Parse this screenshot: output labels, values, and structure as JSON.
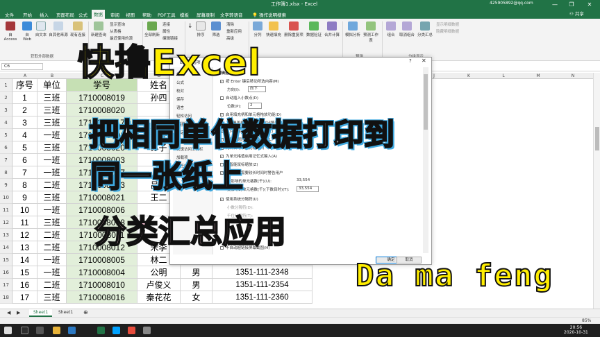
{
  "window": {
    "title": "工作簿1.xlsx - Excel",
    "account": "425905892@qq.com",
    "minimize": "—",
    "restore": "❐",
    "close": "✕"
  },
  "menu": {
    "tabs": [
      "文件",
      "开始",
      "插入",
      "页面布局",
      "公式",
      "数据",
      "审阅",
      "视图",
      "帮助",
      "PDF工具",
      "模板",
      "屏幕录制",
      "文字转语音",
      "操作说明搜索"
    ],
    "active_index": 5,
    "share": "共享"
  },
  "ribbon": {
    "get_external_access": "自 Access",
    "get_external_web": "自 Web",
    "get_external_text": "自文本",
    "get_external_other": "自其他来源",
    "existing_connections": "现有连接",
    "new_query": "新建查询",
    "show_query": "显示查询",
    "from_table": "从表格",
    "recent_sources": "最近使用的源",
    "refresh_all": "全部刷新",
    "connections": "连接",
    "properties": "属性",
    "edit_links": "编辑链接",
    "sort_asc": "↓",
    "sort": "排序",
    "filter": "筛选",
    "clear": "清除",
    "reapply": "重新应用",
    "advanced": "高级",
    "text_to_columns": "分列",
    "flash_fill": "快速填充",
    "remove_duplicates": "删除重复项",
    "data_validation": "数据验证",
    "consolidate": "合并计算",
    "what_if": "模拟分析",
    "forecast_sheet": "预测工作表",
    "group": "组合",
    "ungroup": "取消组合",
    "subtotal": "分类汇总",
    "show_detail": "显示明细数据",
    "hide_detail": "隐藏明细数据",
    "group_external": "获取外部数据",
    "group_forecast": "预测",
    "group_outline": "分级显示"
  },
  "formula_bar": {
    "name_box": "C6"
  },
  "columns": [
    "A",
    "B",
    "C",
    "D",
    "E",
    "F",
    "G",
    "H",
    "I",
    "J",
    "K",
    "L",
    "M",
    "N"
  ],
  "rows": [
    "1",
    "2",
    "3",
    "4",
    "5",
    "6",
    "7",
    "8",
    "9",
    "10",
    "11",
    "12",
    "13",
    "14",
    "15",
    "16",
    "17",
    "18"
  ],
  "table": {
    "headers": [
      "序号",
      "单位",
      "学号",
      "姓名",
      "",
      ""
    ],
    "rows": [
      [
        "1",
        "三班",
        "1710008019",
        "孙四",
        "",
        ""
      ],
      [
        "2",
        "三班",
        "1710008020",
        "",
        "",
        ""
      ],
      [
        "3",
        "三班",
        "1710008017",
        "",
        "",
        ""
      ],
      [
        "4",
        "一班",
        "1710008001",
        "李五",
        "",
        ""
      ],
      [
        "5",
        "三班",
        "1710008020",
        "苏子",
        "",
        ""
      ],
      [
        "6",
        "一班",
        "1710008003",
        "",
        "",
        ""
      ],
      [
        "7",
        "一班",
        "1710008007",
        "",
        "",
        ""
      ],
      [
        "8",
        "二班",
        "1710008013",
        "吕名",
        "",
        ""
      ],
      [
        "9",
        "三班",
        "1710008021",
        "王二",
        "",
        ""
      ],
      [
        "10",
        "一班",
        "1710008006",
        "",
        "",
        ""
      ],
      [
        "11",
        "三班",
        "1710008018",
        "",
        "",
        ""
      ],
      [
        "12",
        "二班",
        "1710008011",
        "",
        "",
        ""
      ],
      [
        "13",
        "二班",
        "1710008012",
        "宋李",
        "",
        ""
      ],
      [
        "14",
        "一班",
        "1710008005",
        "林二",
        "",
        ""
      ],
      [
        "15",
        "一班",
        "1710008004",
        "公明",
        "男",
        "1351-111-2348"
      ],
      [
        "16",
        "二班",
        "1710008010",
        "卢俊义",
        "男",
        "1351-111-2354"
      ],
      [
        "17",
        "三班",
        "1710008016",
        "秦花花",
        "女",
        "1351-111-2360"
      ]
    ]
  },
  "dialog": {
    "title": "Excel 选项",
    "help": "?",
    "close": "✕",
    "nav": [
      "常规",
      "公式",
      "校对",
      "保存",
      "语言",
      "轻松访问",
      "高级",
      "自定义功能区",
      "快速访问工具栏",
      "加载项",
      "信任中心"
    ],
    "section": "编辑选项",
    "opt_enter": "按 Enter 键后移动所选内容(M)",
    "direction_label": "方向(I):",
    "direction_value": "向下",
    "opt_decimal": "自动插入小数点(D)",
    "decimal_places_label": "位数(P):",
    "decimal_places_value": "2",
    "opt_fill": "启用填充柄和单元格拖放功能(D)",
    "opt_overwrite": "覆盖单元格内容前发出警告(A)",
    "opt_direct_edit": "允许直接在单元格内编辑(E)",
    "opt_extend": "扩展数据区域格式及公式(L)",
    "opt_percent": "允许自动百分比输入(I)",
    "opt_autocomplete": "为单元格值启用记忆式键入(A)",
    "opt_zoom": "用智能鼠标缩放(Z)",
    "opt_alert": "操作可能需要较长时间时警告用户",
    "cells_label": "受影响的单元格数(千)(U):",
    "cells_value": "33,554",
    "cells_label2": "受影响的单元格数(千)(下数目时)(T):",
    "cells_value2": "33,554",
    "opt_separators": "使用系统分隔符(U)",
    "decimal_sep": "小数分隔符(D):",
    "thousands_sep": "千位分隔符(T):",
    "opt_no_hyperlink": "不自动超链接屏幕截图(H)",
    "ok": "确定",
    "cancel": "取消"
  },
  "sheets": [
    "Sheet1",
    "Sheet1"
  ],
  "add_sheet": "⊕",
  "status": {
    "zoom": "85%"
  },
  "taskbar": {
    "time": "20:56",
    "date": "2020-10-31"
  },
  "captions": {
    "title": "快撸Excel",
    "line1": "把相同单位数据打印到",
    "line2": "同一张纸上",
    "subtitle": "分类汇总应用",
    "brand": "Da ma feng"
  },
  "colors": {
    "excel_green": "#217346",
    "caption_yellow": "#ffee00",
    "caption_blue_glow": "#3fa9e0",
    "caption_pink": "#ffc8dc"
  }
}
